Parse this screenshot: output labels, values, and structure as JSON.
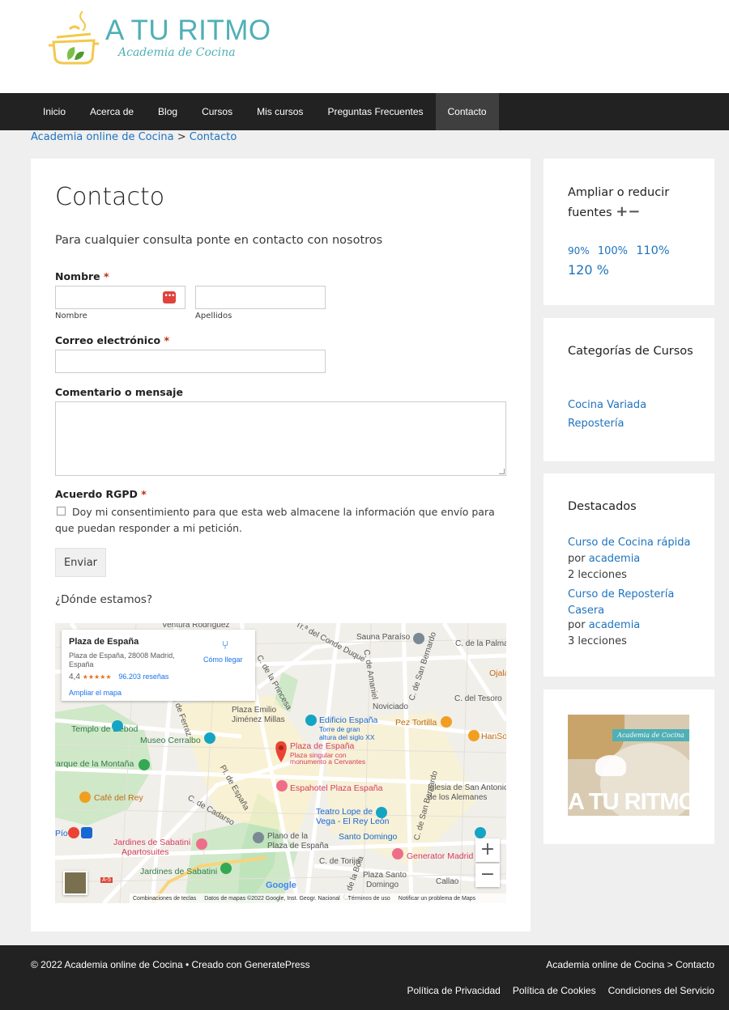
{
  "brand": {
    "title": "A TU RITMO",
    "subtitle": "Academia de Cocina"
  },
  "nav": [
    "Inicio",
    "Acerca de",
    "Blog",
    "Cursos",
    "Mis cursos",
    "Preguntas Frecuentes",
    "Contacto"
  ],
  "breadcrumb": {
    "home": "Academia online de Cocina",
    "sep": ">",
    "current": "Contacto"
  },
  "page": {
    "title": "Contacto",
    "intro": "Para cualquier consulta ponte en contacto con nosotros",
    "form": {
      "name_label": "Nombre",
      "required_mark": "*",
      "first_sub": "Nombre",
      "last_sub": "Apellidos",
      "email_label": "Correo electrónico",
      "comment_label": "Comentario o mensaje",
      "gdpr_label": "Acuerdo RGPD",
      "consent": "Doy mi consentimiento para que esta web almacene la información que envío para que puedan responder a mi petición.",
      "submit": "Enviar"
    },
    "where": "¿Dónde estamos?"
  },
  "map": {
    "place": "Plaza de España",
    "address": "Plaza de España, 28008 Madrid, España",
    "rating": "4,4",
    "stars": "★★★★★",
    "reviews": "96.203 reseñas",
    "enlarge": "Ampliar el mapa",
    "directions": "Cómo llegar",
    "labels": {
      "ventura": "Ventura Rodríguez",
      "sauna": "Sauna Paraíso",
      "palma": "C. de la Palma",
      "ojala": "Ojalá",
      "duque": "Tr.ª del Conde Duque",
      "amaniel": "C. de Amaniel",
      "bernardo": "C. de San Bernardo",
      "princesa": "C. de la Princesa",
      "tesoro": "C. del Tesoro",
      "noviciado": "Noviciado",
      "plaza_emilio": "Plaza Emilio",
      "jimenez": "Jiménez Millas",
      "edificio": "Edificio España",
      "torre": "Torre de gran",
      "altura": "altura del siglo XX",
      "pez": "Pez Tortilla",
      "debod": "Templo de Debod",
      "cerralbo": "Museo Cerralbo",
      "ferraz": "C. de Ferraz",
      "hans": "HanSo",
      "plaza_esp": "Plaza de España",
      "singular": "Plaza singular con",
      "monumento": "monumento a Cervantes",
      "montana": "Parque de la Montaña",
      "espahotel": "Espahotel Plaza España",
      "iglesia": "Iglesia de San Antonio",
      "alemanes": "de los Alemanes",
      "cafe": "Café del Rey",
      "cadarso": "C. de Cadarso",
      "pl_espana": "Pl. de España",
      "teatro": "Teatro Lope de",
      "rey_leon": "Vega - El Rey León",
      "pio": "Pío",
      "sabatini": "Jardines de Sabatini",
      "aparto": "Apartosuites",
      "plano": "Plano de la",
      "plaza_de_esp": "Plaza de España",
      "santo_domingo": "Santo Domingo",
      "generator": "Generator Madrid",
      "torija": "C. de Torija",
      "jardines2": "Jardines de Sabatini",
      "a5": "A-5",
      "bola": "C. de la Bola",
      "plaza_santo": "Plaza Santo",
      "domingo": "Domingo",
      "callao": "Callao",
      "san_bernardo2": "C. de San Bernardo"
    },
    "zoom_in": "+",
    "zoom_out": "−",
    "google": "Google",
    "attribution": [
      "Combinaciones de teclas",
      "Datos de mapas ©2022 Google, Inst. Geogr. Nacional",
      "Términos de uso",
      "Notificar un problema de Maps"
    ]
  },
  "sidebar": {
    "fonts": {
      "title": "Ampliar o reducir fuentes",
      "plus": "+",
      "minus": "−",
      "sizes": [
        "90%",
        "100%",
        "110%",
        "120 %"
      ]
    },
    "categories": {
      "title": "Categorías de Cursos",
      "items": [
        "Cocina Variada",
        "Repostería"
      ]
    },
    "featured": {
      "title": "Destacados",
      "items": [
        {
          "course": "Curso de Cocina rápida",
          "by": "por",
          "author": "academia",
          "lessons": "2 lecciones"
        },
        {
          "course": "Curso de Repostería Casera",
          "by": "por",
          "author": "academia",
          "lessons": "3 lecciones"
        }
      ]
    },
    "promo": {
      "caption": "Academia de Cocina",
      "brand": "A TU RITMO"
    }
  },
  "footer": {
    "copyright": "© 2022 Academia online de Cocina • Creado con GeneratePress",
    "breadcrumb": "Academia online de Cocina > Contacto",
    "links": [
      "Política de Privacidad",
      "Política de Cookies",
      "Condiciones del Servicio"
    ]
  },
  "colors": {
    "brand": "#4fb0b6",
    "nav": "#222222",
    "link": "#1e73be",
    "required": "#c02b0a"
  }
}
